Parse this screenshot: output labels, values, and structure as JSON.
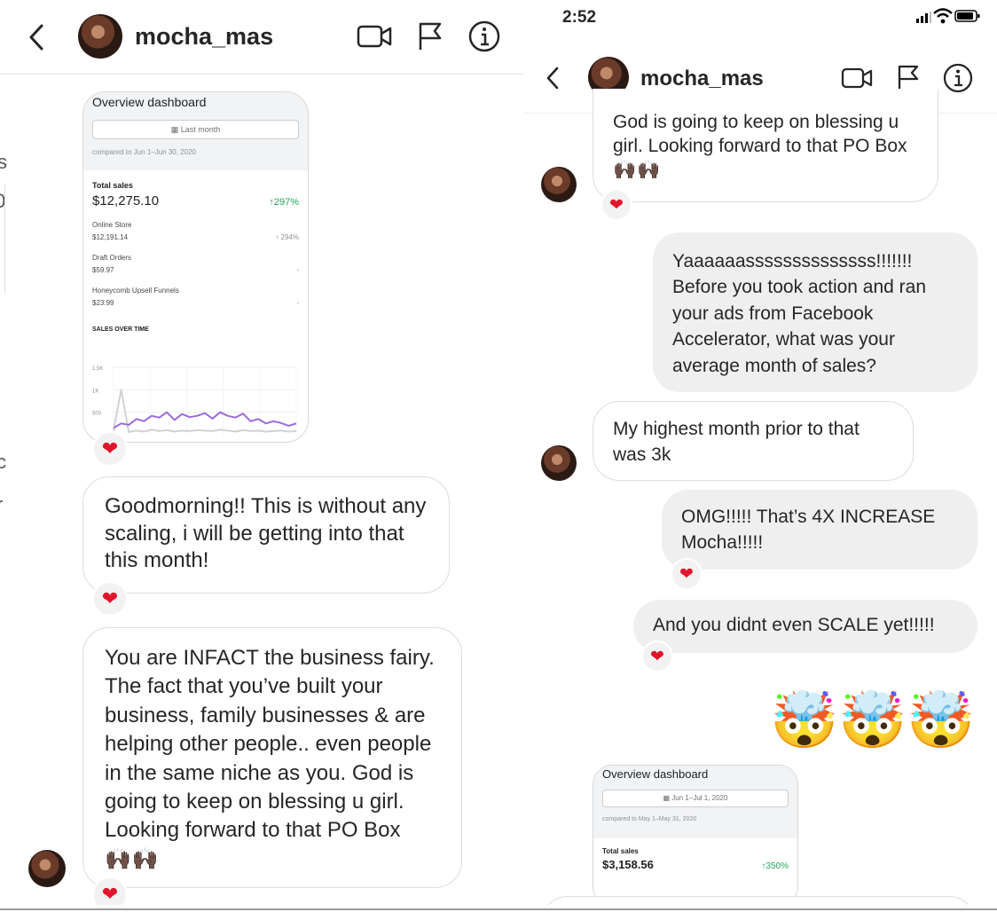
{
  "left": {
    "header": {
      "username": "mocha_mas"
    },
    "dashboard": {
      "title": "Overview dashboard",
      "date_button": "Last month",
      "compared": "compared to Jun 1–Jun 30, 2020",
      "total_label": "Total sales",
      "total_value": "$12,275.10",
      "total_pct": "↑297%",
      "rows": [
        {
          "label": "Online Store",
          "value": "$12,191.14",
          "change": "↑ 294%"
        },
        {
          "label": "Draft Orders",
          "value": "$59.97",
          "change": "-"
        },
        {
          "label": "Honeycomb Upsell Funnels",
          "value": "$23.99",
          "change": "-"
        }
      ],
      "chart_title": "SALES OVER TIME",
      "chart_data": {
        "type": "line",
        "ylim": [
          0,
          1500
        ],
        "yticks": [
          "1.5K",
          "1K",
          "500"
        ],
        "series": [
          {
            "color": "#9c6ade",
            "values": [
              150,
              250,
              220,
              350,
              300,
              420,
              380,
              500,
              330,
              460,
              390,
              420,
              480,
              360,
              500,
              420,
              380,
              470,
              300,
              350,
              250,
              300,
              260,
              200,
              250
            ]
          },
          {
            "color": "#cfd2d6",
            "values": [
              80,
              1000,
              60,
              90,
              70,
              110,
              80,
              100,
              70,
              90,
              80,
              100,
              90,
              80,
              110,
              90,
              70,
              100,
              80,
              90,
              70,
              80,
              90,
              70,
              80
            ]
          }
        ]
      }
    },
    "messages": [
      "Goodmorning!! This is without any scaling, i will be getting into that this month!",
      "You are INFACT the business fairy. The fact that you’ve built your business, family businesses & are helping other people.. even people in the same niche as you. God is going to keep on blessing u girl. Looking forward to that PO Box"
    ],
    "cut_letters": [
      "s",
      "0",
      "c",
      "r",
      "l"
    ]
  },
  "right": {
    "status": {
      "time": "2:52"
    },
    "header": {
      "username": "mocha_mas"
    },
    "messages": [
      {
        "side": "in",
        "text": "God is going to keep on blessing u girl. Looking forward to that PO Box"
      },
      {
        "side": "out",
        "text": "Yaaaaaassssssssssssss!!!!!!! Before you took action and ran your ads from Facebook Accelerator, what was your average month of sales?"
      },
      {
        "side": "in",
        "text": "My highest month prior to that was 3k"
      },
      {
        "side": "out",
        "text": "OMG!!!!! That’s 4X INCREASE Mocha!!!!!"
      },
      {
        "side": "out",
        "text": "And you didnt even SCALE yet!!!!!"
      }
    ],
    "emoji": "🤯🤯🤯",
    "dashboard": {
      "title": "Overview dashboard",
      "date_button": "Jun 1–Jul 1, 2020",
      "compared": "compared to May 1–May 31, 2020",
      "total_label": "Total sales",
      "total_value": "$3,158.56",
      "total_pct": "↑350%"
    }
  },
  "icons": {
    "hands": "🙌🏿🙌🏿",
    "heart": "❤"
  }
}
